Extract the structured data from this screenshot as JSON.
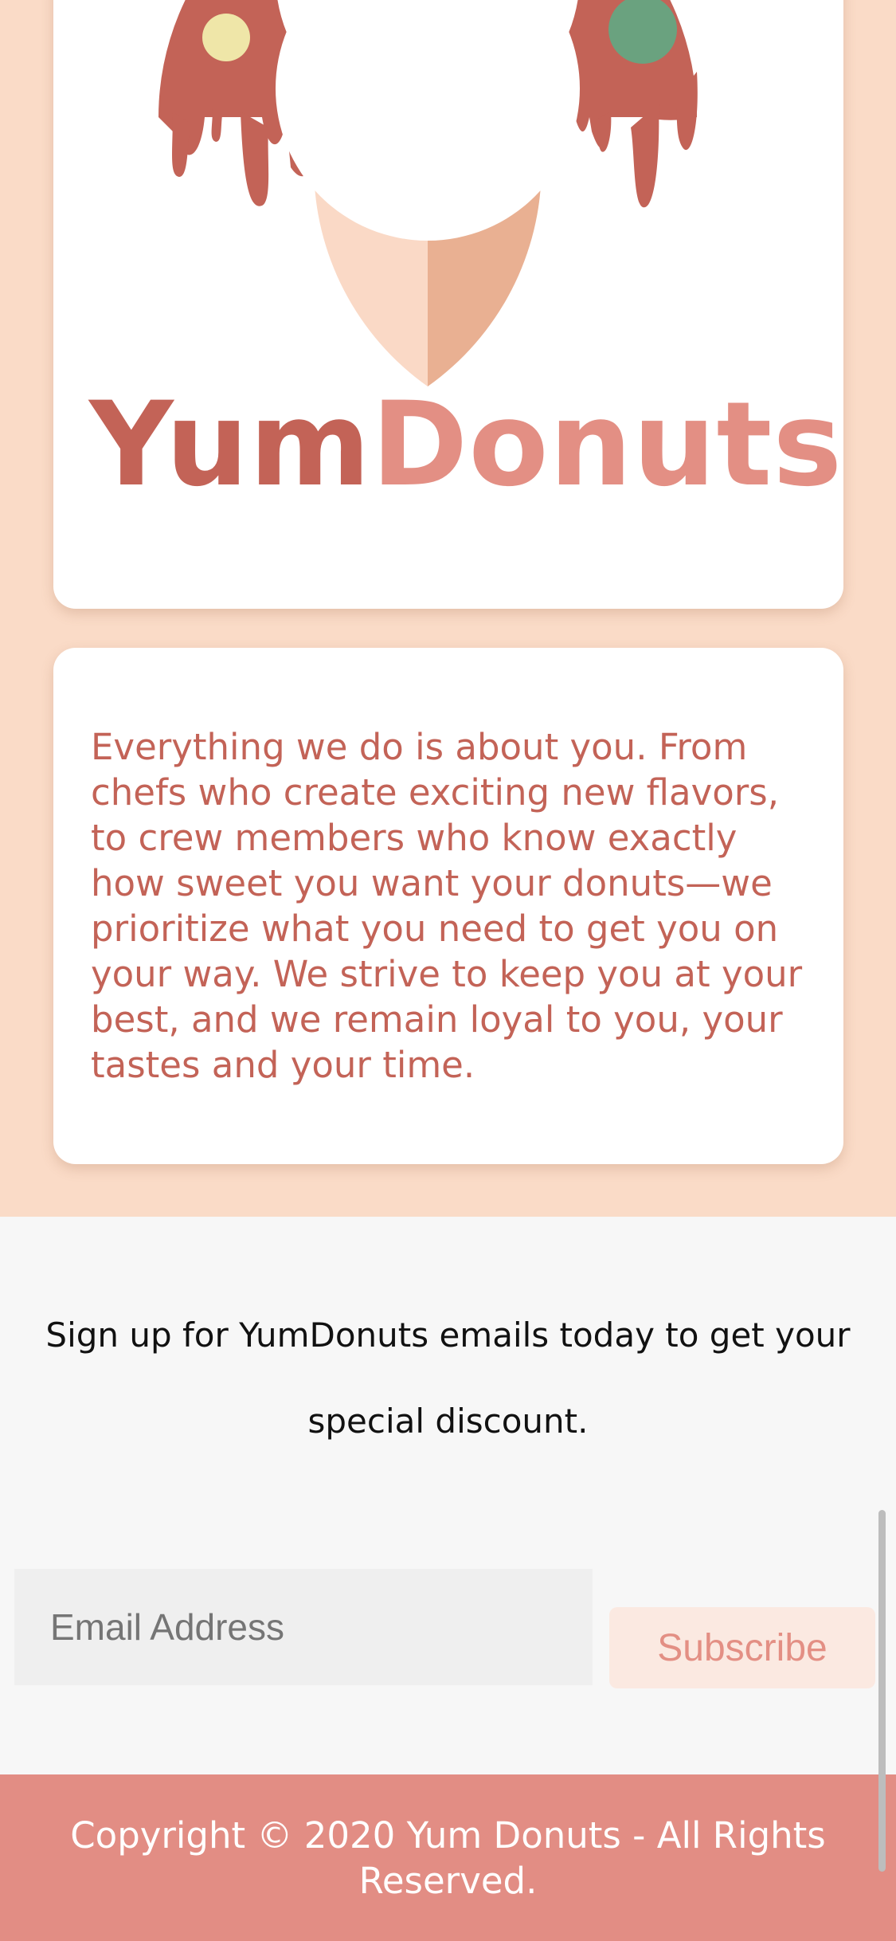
{
  "brand": {
    "logo_part1": "Yum",
    "logo_part2": "Donuts"
  },
  "about": {
    "text": "Everything we do is about you. From chefs who create exciting new flavors, to crew members who know exactly how sweet you want your donuts—we prioritize what you need to get you on your way. We strive to keep you at your best, and we remain loyal to you, your tastes and your time."
  },
  "signup": {
    "prompt": "Sign up for YumDonuts emails today to get your special discount.",
    "email_placeholder": "Email Address",
    "subscribe_label": "Subscribe"
  },
  "footer": {
    "copyright": "Copyright © 2020 Yum Donuts - All Rights Reserved."
  },
  "colors": {
    "page_background": "#fadbc7",
    "card_background": "#ffffff",
    "brand_dark": "#c36357",
    "brand_light": "#e38f84",
    "signup_background": "#f7f7f7",
    "footer_background": "#e28d84"
  }
}
